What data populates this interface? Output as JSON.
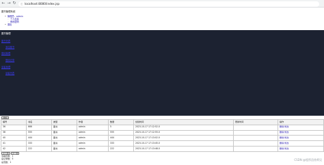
{
  "browser": {
    "url": "localhost:8080/index.jsp"
  },
  "header": {
    "site_title": "图书管理系统",
    "tree": {
      "user_label": "管理员：admin",
      "sub_items": [
        "个人信息",
        "修改密码"
      ],
      "logout": "退出"
    }
  },
  "panel": {
    "title": "图书管理",
    "links": [
      "图书列表",
      "添加图书",
      "借阅管理",
      "借阅记录",
      "读者管理",
      "读者列表"
    ]
  },
  "table_toolbar": {
    "button_label": "添加"
  },
  "table": {
    "columns": [
      "编号",
      "书名",
      "类型",
      "作者",
      "数量",
      "创建时间",
      "更新时间",
      "操作"
    ],
    "rows": [
      [
        "36",
        "666",
        "图书",
        "admin",
        "5",
        "2023-10-17 17:12:52.0",
        "",
        "删除 修改"
      ],
      [
        "38",
        "555",
        "图书",
        "admin",
        "555",
        "2023-10-17 17:12:55.0",
        "",
        "删除 修改"
      ],
      [
        "40",
        "444",
        "图书",
        "admin",
        "444",
        "2023-10-17 17:13:02.0",
        "",
        "删除 修改"
      ],
      [
        "41",
        "333",
        "图书",
        "admin",
        "333",
        "2023-10-17 17:13:45.0",
        "",
        "删除 修改"
      ],
      [
        "42",
        "222",
        "图书",
        "admin",
        "222",
        "2023-10-17 17:13:48.0",
        "",
        "删除 修改"
      ]
    ]
  },
  "pager": {
    "buttons": [
      "上一页",
      "下一页"
    ],
    "current_page": "当前页数：1",
    "total_records": "总记录数：5",
    "total_pages": "总页数：1"
  },
  "watermark": "CSDN @程序员徐师兄"
}
